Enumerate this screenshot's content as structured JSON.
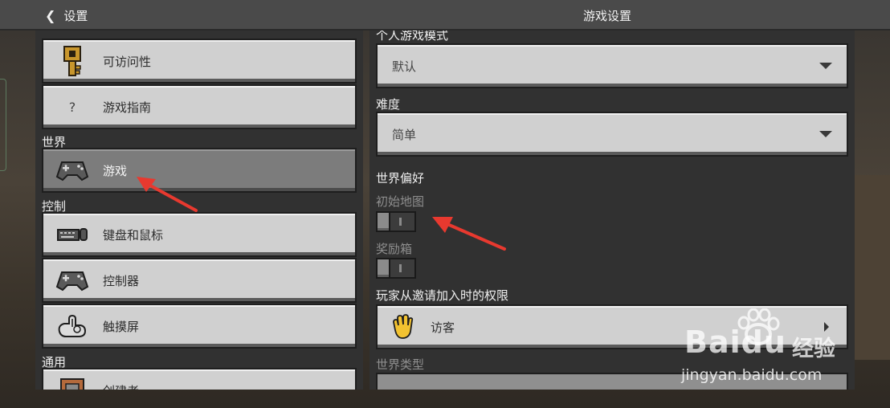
{
  "header": {
    "back_label": "设置",
    "title": "游戏设置"
  },
  "sidebar": {
    "items_top": [
      {
        "label": "可访问性",
        "icon": "key-icon"
      },
      {
        "label": "游戏指南",
        "icon": "question-icon",
        "icon_glyph": "?"
      }
    ],
    "section_world": "世界",
    "item_game": {
      "label": "游戏",
      "icon": "gamepad-icon"
    },
    "section_controls": "控制",
    "items_controls": [
      {
        "label": "键盘和鼠标",
        "icon": "keyboard-mouse-icon"
      },
      {
        "label": "控制器",
        "icon": "controller-icon"
      },
      {
        "label": "触摸屏",
        "icon": "touch-icon"
      }
    ],
    "section_general": "通用",
    "item_creator": {
      "label": "创建者",
      "icon": "creator-icon"
    }
  },
  "main": {
    "game_mode_label": "个人游戏模式",
    "game_mode_value": "默认",
    "difficulty_label": "难度",
    "difficulty_value": "简单",
    "world_prefs_label": "世界偏好",
    "starting_map_label": "初始地图",
    "starting_map_on": false,
    "bonus_chest_label": "奖励箱",
    "bonus_chest_on": false,
    "invite_perm_label": "玩家从邀请加入时的权限",
    "invite_perm_value": "访客",
    "world_type_label": "世界类型"
  },
  "watermark": {
    "brand": "Baidu",
    "brand_cn": "经验",
    "url": "jingyan.baidu.com"
  },
  "colors": {
    "button_face": "#d0d0d0",
    "button_active": "#7c7c7c",
    "panel_bg": "#313131",
    "annotation_red": "#e8392f"
  }
}
